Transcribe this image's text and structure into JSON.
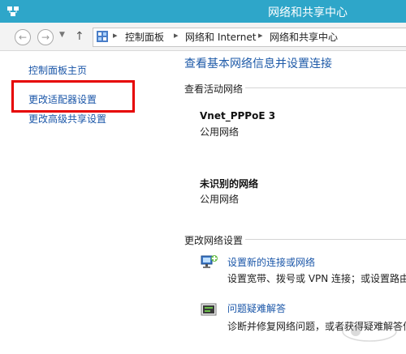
{
  "window": {
    "title": "网络和共享中心",
    "accent_color": "#2ea6c9",
    "app_icon": "network-icon"
  },
  "address_bar": {
    "back_icon": "back-arrow-icon",
    "forward_icon": "forward-arrow-icon",
    "up_icon": "up-arrow-icon",
    "crumbs": [
      "控制面板",
      "网络和 Internet",
      "网络和共享中心"
    ]
  },
  "sidebar": {
    "items": [
      {
        "label": "控制面板主页"
      },
      {
        "label": "更改适配器设置"
      },
      {
        "label": "更改高级共享设置"
      }
    ],
    "highlight_color": "#e60000"
  },
  "main": {
    "title": "查看基本网络信息并设置连接",
    "active_networks_heading": "查看活动网络",
    "networks": [
      {
        "name": "Vnet_PPPoE  3",
        "type": "公用网络"
      },
      {
        "name": "未识别的网络",
        "type": "公用网络"
      }
    ],
    "change_settings_heading": "更改网络设置",
    "tasks": [
      {
        "icon": "new-connection-icon",
        "link": "设置新的连接或网络",
        "desc": "设置宽带、拨号或 VPN 连接；或设置路由"
      },
      {
        "icon": "troubleshoot-icon",
        "link": "问题疑难解答",
        "desc": "诊断并修复网络问题，或者获得疑难解答信"
      }
    ]
  }
}
